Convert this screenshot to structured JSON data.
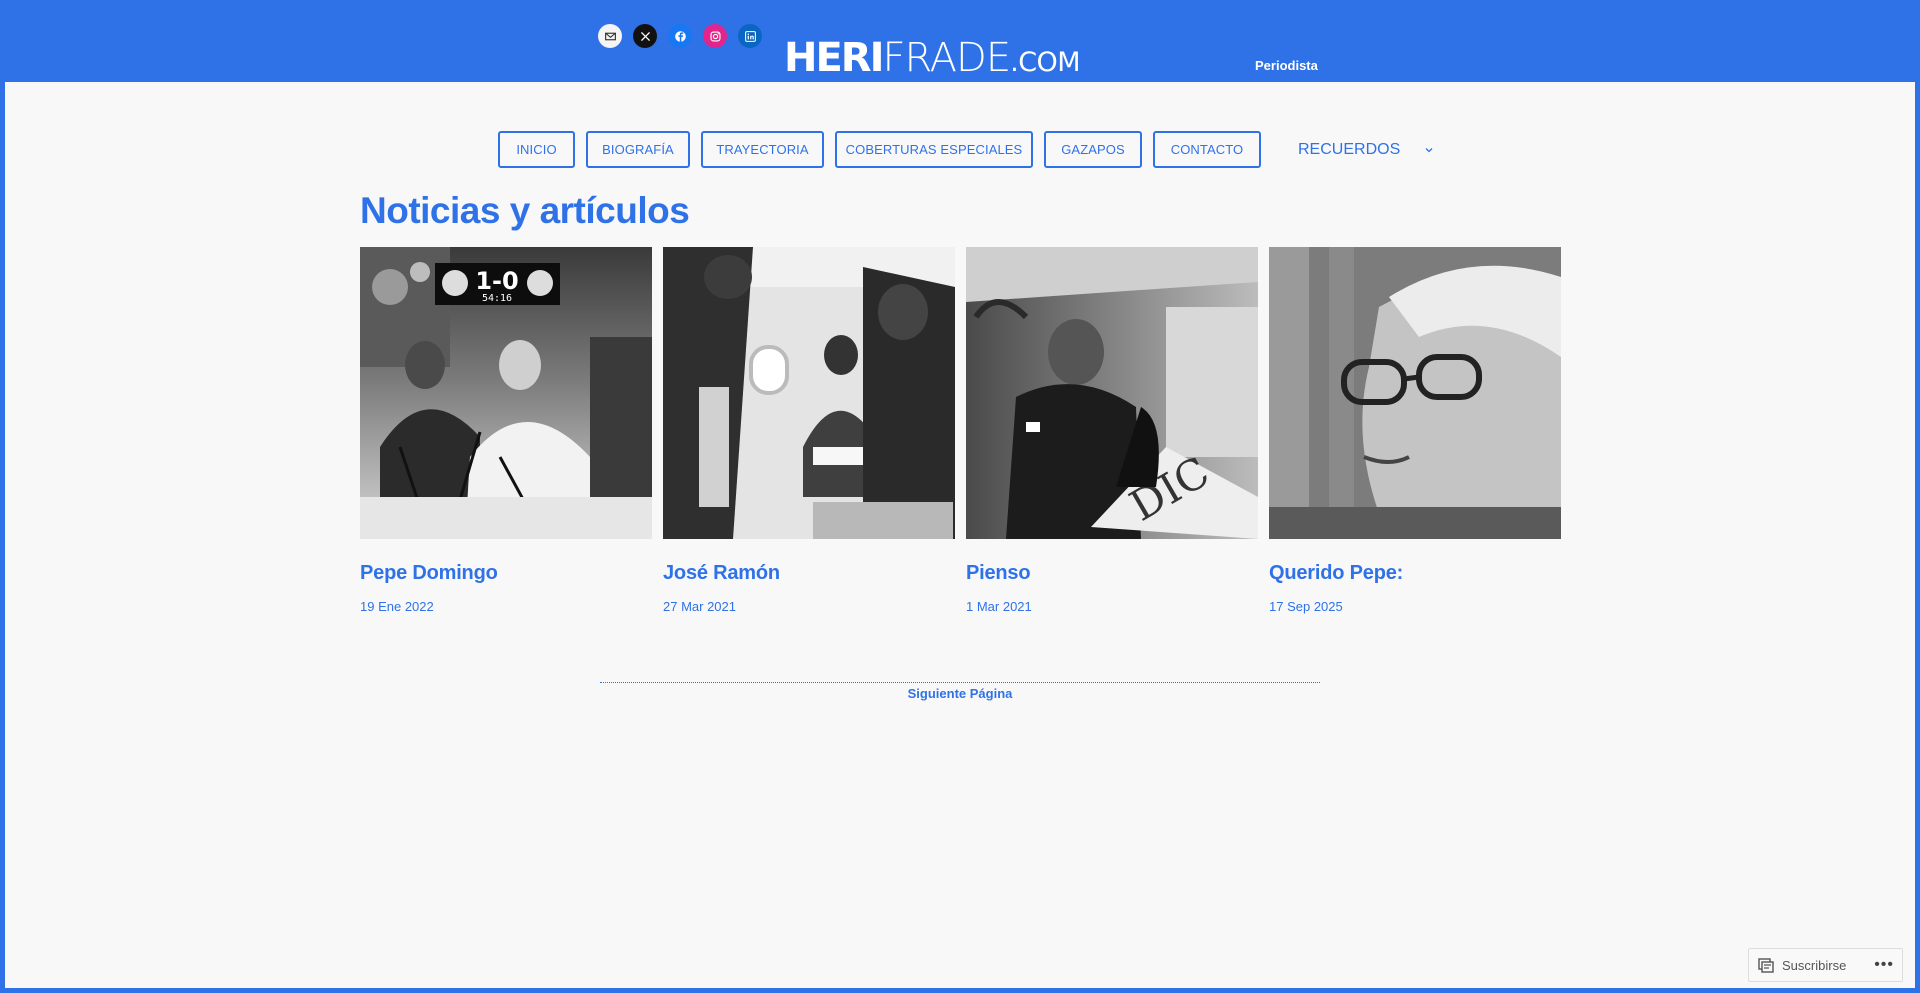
{
  "header": {
    "logo": {
      "part1": "HERI",
      "part2": "FRADE",
      "part3": ".COM"
    },
    "tagline": "Periodista",
    "socials": [
      {
        "icon": "mail-icon"
      },
      {
        "icon": "x-icon"
      },
      {
        "icon": "facebook-icon"
      },
      {
        "icon": "instagram-icon"
      },
      {
        "icon": "linkedin-icon"
      }
    ]
  },
  "nav": {
    "items": [
      "INICIO",
      "BIOGRAFÍA",
      "TRAYECTORIA",
      "COBERTURAS ESPECIALES",
      "GAZAPOS",
      "CONTACTO"
    ],
    "dropdown_label": "RECUERDOS"
  },
  "main": {
    "title": "Noticias y artículos",
    "posts": [
      {
        "title": "Pepe Domingo",
        "date": "19 Ene 2022",
        "score": "1-0",
        "clock": "54:16"
      },
      {
        "title": "José Ramón",
        "date": "27 Mar 2021"
      },
      {
        "title": "Pienso",
        "date": "1 Mar 2021",
        "paper_text": "DIC"
      },
      {
        "title": "Querido Pepe:",
        "date": "17 Sep 2025"
      }
    ],
    "next_page": "Siguiente Página"
  },
  "subscribe": {
    "label": "Suscribirse",
    "more": "•••"
  },
  "colors": {
    "brand": "#2f72e8",
    "background": "#f8f8f8"
  }
}
